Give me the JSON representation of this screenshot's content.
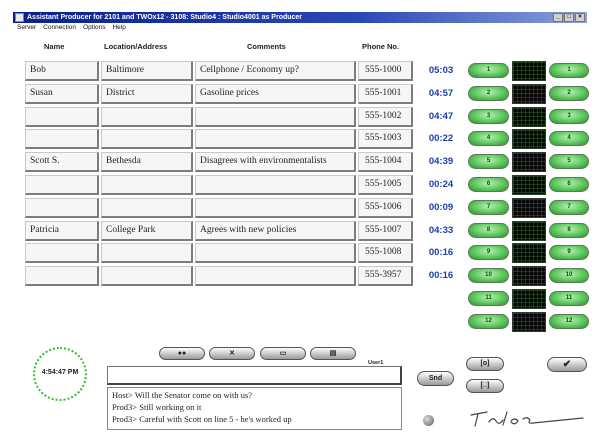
{
  "window": {
    "title": "Assistant Producer for 2101 and TWOx12 - 3108: Studio4 : Studio4001 as Producer"
  },
  "menu": [
    "Server",
    "Connection",
    "Options",
    "Help"
  ],
  "columns": {
    "name": "Name",
    "location": "Location/Address",
    "comments": "Comments",
    "phone": "Phone No."
  },
  "lines": [
    {
      "name": "Bob",
      "location": "Baltimore",
      "comment": "Cellphone / Economy up?",
      "phone": "555-1000",
      "timer": "05:03",
      "left_btn": "1",
      "right_btn": "1"
    },
    {
      "name": "Susan",
      "location": "District",
      "comment": "Gasoline prices",
      "phone": "555-1001",
      "timer": "04:57",
      "left_btn": "2",
      "right_btn": "2"
    },
    {
      "name": "",
      "location": "",
      "comment": "",
      "phone": "555-1002",
      "timer": "04:47",
      "left_btn": "3",
      "right_btn": "3"
    },
    {
      "name": "",
      "location": "",
      "comment": "",
      "phone": "555-1003",
      "timer": "00:22",
      "left_btn": "4",
      "right_btn": "4"
    },
    {
      "name": "Scott S.",
      "location": "Bethesda",
      "comment": "Disagrees with environmentalists",
      "phone": "555-1004",
      "timer": "04:39",
      "left_btn": "5",
      "right_btn": "5"
    },
    {
      "name": "",
      "location": "",
      "comment": "",
      "phone": "555-1005",
      "timer": "00:24",
      "left_btn": "6",
      "right_btn": "6"
    },
    {
      "name": "",
      "location": "",
      "comment": "",
      "phone": "555-1006",
      "timer": "00:09",
      "left_btn": "7",
      "right_btn": "7"
    },
    {
      "name": "Patricia",
      "location": "College Park",
      "comment": "Agrees with new policies",
      "phone": "555-1007",
      "timer": "04:33",
      "left_btn": "8",
      "right_btn": "8"
    },
    {
      "name": "",
      "location": "",
      "comment": "",
      "phone": "555-1008",
      "timer": "00:16",
      "left_btn": "9",
      "right_btn": "9"
    },
    {
      "name": "",
      "location": "",
      "comment": "",
      "phone": "555-3957",
      "timer": "00:16",
      "left_btn": "10",
      "right_btn": "10"
    },
    {
      "name": "",
      "location": "",
      "comment": "",
      "phone": "",
      "timer": "",
      "left_btn": "11",
      "right_btn": "11"
    },
    {
      "name": "",
      "location": "",
      "comment": "",
      "phone": "",
      "timer": "",
      "left_btn": "12",
      "right_btn": "12"
    }
  ],
  "clock": {
    "time": "4:54:47 PM"
  },
  "toolbar": [
    "●●",
    "✕",
    "▭",
    "▤"
  ],
  "user": {
    "label": "User1",
    "input": ""
  },
  "chat": [
    "Host> Will the Senator come on with us?",
    "Prod3> Still working on it",
    "Prod3> Careful with Scott on line 5 - he's worked up"
  ],
  "buttons": {
    "send": "Snd",
    "small1": "[o]",
    "small2": "[□]",
    "check": "✔"
  },
  "colors": {
    "timer": "#1a3db0",
    "pill": "#5cc85c",
    "meter": "#050805",
    "title": "#0a1f8a"
  },
  "icons": {
    "logo": "telos-logo",
    "status": "status-dot-icon"
  }
}
